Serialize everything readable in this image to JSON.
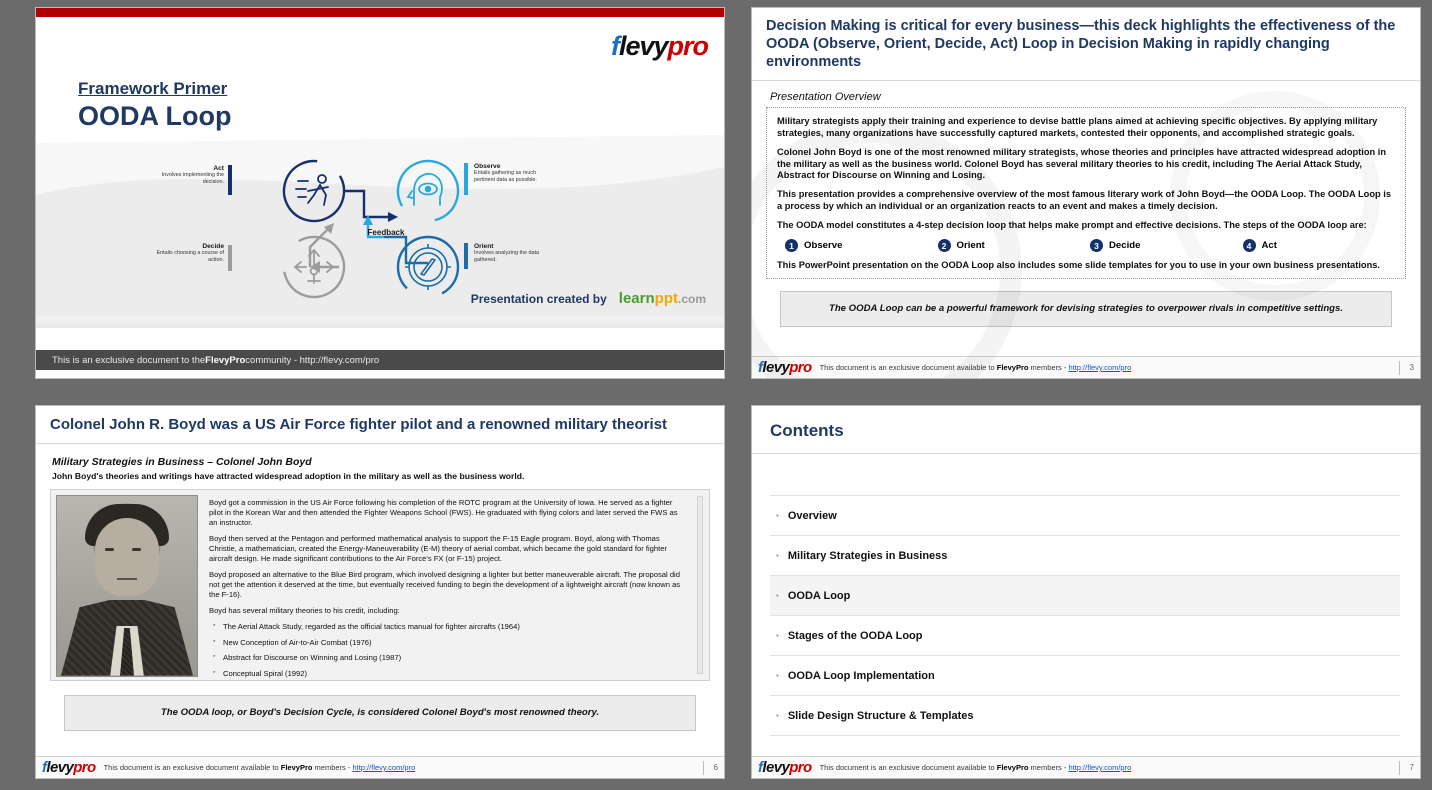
{
  "slide1": {
    "kicker": "Framework Primer",
    "title": "OODA Loop",
    "logo": {
      "part1": "f",
      "part2": "levy",
      "part3": "pro"
    },
    "created_by_label": "Presentation created by",
    "learnppt": {
      "name": "learnppt",
      "suffix": ".com"
    },
    "footer_strip": {
      "pre": "This is an exclusive document to the ",
      "brand": "FlevyPro",
      "post": " community - http://flevy.com/pro"
    },
    "diagram": {
      "feedback_label": "Feedback",
      "nodes": [
        {
          "id": "act",
          "label": "Act",
          "desc": "Involves implementing the decision.",
          "color": "#15306b"
        },
        {
          "id": "observe",
          "label": "Observe",
          "desc": "Entails gathering as much pertinent data as possible.",
          "color": "#29a8df"
        },
        {
          "id": "decide",
          "label": "Decide",
          "desc": "Entails choosing a course of action.",
          "color": "#9c9c9c"
        },
        {
          "id": "orient",
          "label": "Orient",
          "desc": "Involves analyzing the data gathered.",
          "color": "#1b6ca8"
        }
      ]
    }
  },
  "slide2": {
    "title": "Decision Making is critical for every business—this deck highlights the effectiveness of the OODA (Observe, Orient, Decide, Act) Loop in Decision Making in rapidly changing environments",
    "subtitle": "Presentation Overview",
    "paragraphs": [
      "Military strategists apply their training and experience to devise battle plans aimed at achieving specific objectives.  By applying military strategies, many organizations have successfully captured markets, contested their opponents, and accomplished strategic goals.",
      "Colonel John Boyd is one of the most renowned military strategists, whose theories and principles have attracted widespread adoption in the military as well as the business world.  Colonel Boyd has several military theories to his credit, including The Aerial Attack Study, Abstract for Discourse on Winning and Losing.",
      "This presentation provides a comprehensive overview of the most famous literary work of John Boyd—the OODA Loop.  The OODA Loop is a process by which an individual or an organization reacts to an event and makes a timely decision.",
      "The OODA model constitutes a 4-step decision loop that helps make prompt and effective decisions.  The steps of the OODA loop are:"
    ],
    "steps": [
      {
        "number": "1",
        "label": "Observe"
      },
      {
        "number": "2",
        "label": "Orient"
      },
      {
        "number": "3",
        "label": "Decide"
      },
      {
        "number": "4",
        "label": "Act"
      }
    ],
    "closing_paragraph": "This PowerPoint presentation on the OODA Loop also includes some slide templates for you to use in your own business presentations.",
    "callout": "The OODA Loop can be a powerful framework for devising strategies to overpower rivals in competitive settings.",
    "footer": {
      "logo": {
        "part1": "f",
        "part2": "levy",
        "part3": "pro"
      },
      "note_pre": "This document is an exclusive document available to ",
      "note_brand": "FlevyPro",
      "note_mid": " members - ",
      "note_link": "http://flevy.com/pro",
      "page": "3"
    }
  },
  "slide3": {
    "title": "Colonel John R. Boyd was a US Air Force fighter pilot and a renowned military theorist",
    "subtitle": "Military Strategies in Business – Colonel John Boyd",
    "lead": "John Boyd's theories and writings have attracted widespread adoption in the military as well as the business world.",
    "photo_alt": "Portrait photograph of Colonel John R. Boyd",
    "paragraphs": [
      "Boyd got a commission in the US Air Force following his completion of the ROTC program at the University of Iowa.  He served as a fighter pilot in the Korean War and then attended the Fighter Weapons School (FWS).  He graduated with flying colors and later served the FWS as an instructor.",
      "Boyd then served at the Pentagon and performed mathematical analysis to support the F-15 Eagle program.  Boyd, along with Thomas Christie, a mathematician, created the Energy-Maneuverability (E-M) theory of aerial combat, which became the gold standard for fighter aircraft design.  He made significant contributions to the Air Force's FX (or F-15) project.",
      "Boyd proposed an alternative to the Blue Bird program, which involved designing a lighter but better maneuverable aircraft.  The proposal did not get the attention it deserved at the time, but eventually received funding to begin the development of a lightweight aircraft (now known as the F-16).",
      "Boyd has several military theories to his credit, including:"
    ],
    "theories": [
      "The Aerial Attack Study, regarded as the official tactics manual for fighter aircrafts (1964)",
      "New Conception of Air-to-Air Combat (1976)",
      "Abstract for Discourse on Winning and Losing (1987)",
      "Conceptual Spiral (1992)"
    ],
    "callout": "The OODA loop, or Boyd's Decision Cycle, is considered Colonel Boyd's most renowned theory.",
    "footer": {
      "logo": {
        "part1": "f",
        "part2": "levy",
        "part3": "pro"
      },
      "note_pre": "This document is an exclusive document available to ",
      "note_brand": "FlevyPro",
      "note_mid": " members - ",
      "note_link": "http://flevy.com/pro",
      "page": "6"
    }
  },
  "slide4": {
    "title": "Contents",
    "items": [
      {
        "label": "Overview",
        "active": false
      },
      {
        "label": "Military Strategies in Business",
        "active": false
      },
      {
        "label": "OODA Loop",
        "active": true
      },
      {
        "label": "Stages of the OODA Loop",
        "active": false
      },
      {
        "label": "OODA Loop Implementation",
        "active": false
      },
      {
        "label": "Slide Design Structure & Templates",
        "active": false
      }
    ],
    "footer": {
      "logo": {
        "part1": "f",
        "part2": "levy",
        "part3": "pro"
      },
      "note_pre": "This document is an exclusive document available to ",
      "note_brand": "FlevyPro",
      "note_mid": " members - ",
      "note_link": "http://flevy.com/pro",
      "page": "7"
    }
  },
  "colors": {
    "accent_navy": "#1f3864",
    "accent_red": "#b00000",
    "badge_navy": "#15306b",
    "observe_blue": "#29a8df",
    "orient_blue": "#1b6ca8",
    "decide_grey": "#9c9c9c",
    "act_navy": "#15306b",
    "page_bg": "#6b6b6b"
  }
}
